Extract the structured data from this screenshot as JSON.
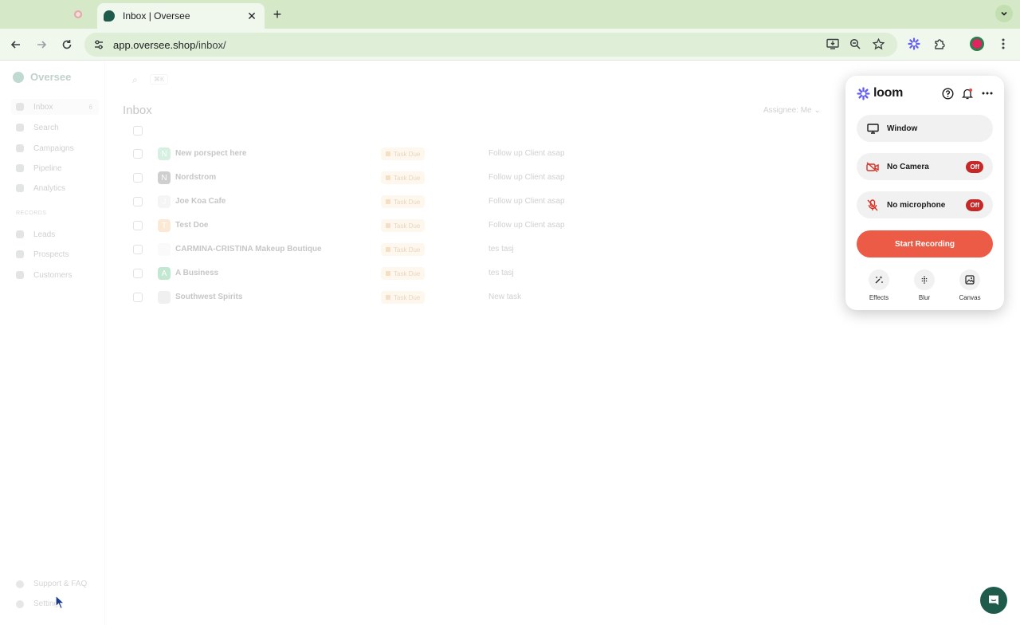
{
  "browser": {
    "active_tab_title": "Inbox | Oversee",
    "tab_close": "✕",
    "new_tab": "+",
    "url_host": "app.oversee.shop",
    "url_path": "/inbox/"
  },
  "app": {
    "brand": "Oversee",
    "nav": [
      {
        "label": "Inbox",
        "count": "6"
      },
      {
        "label": "Search"
      },
      {
        "label": "Campaigns"
      },
      {
        "label": "Pipeline"
      },
      {
        "label": "Analytics"
      }
    ],
    "records_heading": "RECORDS",
    "records": [
      {
        "label": "Leads"
      },
      {
        "label": "Prospects"
      },
      {
        "label": "Customers"
      }
    ],
    "search_shortcut": "⌘K",
    "page_title": "Inbox",
    "assignee_filter": "Assignee: Me",
    "rows": [
      {
        "avatar": "N",
        "avatar_color": "#6fcf97",
        "name": "New porspect here",
        "badge": "Task Due",
        "task": "Follow up Client asap"
      },
      {
        "avatar": "N",
        "avatar_color": "#555555",
        "name": "Nordstrom",
        "badge": "Task Due",
        "task": "Follow up Client asap"
      },
      {
        "avatar": "J",
        "avatar_color": "#dddddd",
        "name": "Joe Koa Cafe",
        "badge": "Task Due",
        "task": "Follow up Client asap"
      },
      {
        "avatar": "T",
        "avatar_color": "#f2b26b",
        "name": "Test Doe",
        "badge": "Task Due",
        "task": "Follow up Client asap"
      },
      {
        "avatar": "",
        "avatar_color": "#eeeeee",
        "name": "CARMINA-CRISTINA Makeup Boutique",
        "badge": "Task Due",
        "task": "tes tasj"
      },
      {
        "avatar": "A",
        "avatar_color": "#27ae60",
        "name": "A Business",
        "badge": "Task Due",
        "task": "tes tasj"
      },
      {
        "avatar": "",
        "avatar_color": "#cccccc",
        "name": "Southwest Spirits",
        "badge": "Task Due",
        "task": "New task"
      }
    ],
    "support_label": "Support & FAQ",
    "settings_label": "Settings"
  },
  "loom": {
    "logo": "loom",
    "window_label": "Window",
    "camera_label": "No Camera",
    "camera_state": "Off",
    "mic_label": "No microphone",
    "mic_state": "Off",
    "record_label": "Start Recording",
    "tools": [
      {
        "label": "Effects",
        "icon": "effects-icon"
      },
      {
        "label": "Blur",
        "icon": "blur-icon"
      },
      {
        "label": "Canvas",
        "icon": "canvas-icon"
      }
    ],
    "accent": "#625df5",
    "record_color": "#ec5b45",
    "off_color": "#c62828"
  }
}
